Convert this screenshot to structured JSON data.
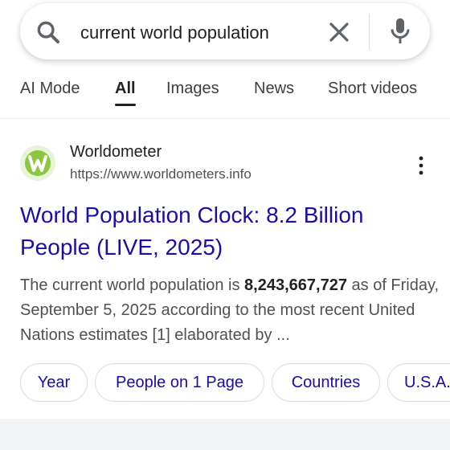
{
  "search": {
    "query": "current world population"
  },
  "tabs": [
    {
      "label": "AI Mode",
      "active": false
    },
    {
      "label": "All",
      "active": true
    },
    {
      "label": "Images",
      "active": false
    },
    {
      "label": "News",
      "active": false
    },
    {
      "label": "Short videos",
      "active": false
    }
  ],
  "result": {
    "site_name": "Worldometer",
    "url": "https://www.worldometers.info",
    "title": "World Population Clock: 8.2 Billion People (LIVE, 2025)",
    "snippet_before": "The current world population is ",
    "snippet_bold": "8,243,667,727",
    "snippet_after": " as of Friday, September 5, 2025 according to the most recent United Nations estimates [1] elaborated by ..."
  },
  "chips": [
    "Year",
    "People on 1 Page",
    "Countries",
    "U.S.A."
  ],
  "colors": {
    "link": "#1a0dab",
    "text": "#202124",
    "secondary_text": "#4d5156",
    "favicon_green": "#8dc63f"
  },
  "icons": [
    "search-icon",
    "clear-icon",
    "mic-icon",
    "worldometer-logo-icon",
    "more-vert-icon"
  ]
}
